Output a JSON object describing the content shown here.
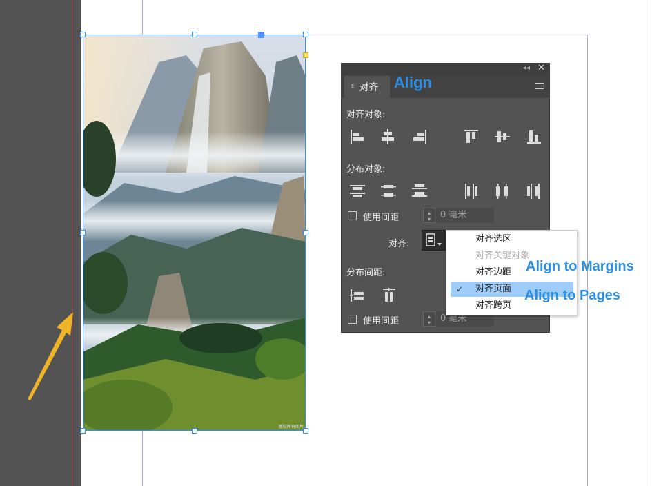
{
  "align_panel": {
    "tab_label": "对齐",
    "sections": {
      "align_objects": "对齐对象:",
      "distribute_objects": "分布对象:",
      "distribute_spacing": "分布间距:"
    },
    "use_spacing_label_1": "使用间距",
    "spacing_value_1": "0 毫米",
    "use_spacing_label_2": "使用间距",
    "spacing_value_2": "0 毫米",
    "align_to_label": "对齐:"
  },
  "align_to_dropdown": {
    "items": [
      {
        "label": "对齐选区",
        "state": "enabled"
      },
      {
        "label": "对齐关键对象",
        "state": "disabled"
      },
      {
        "label": "对齐边距",
        "state": "enabled"
      },
      {
        "label": "对齐页面",
        "state": "selected"
      },
      {
        "label": "对齐跨页",
        "state": "enabled"
      }
    ],
    "check_mark": "✓"
  },
  "annotations": {
    "align": "Align",
    "align_to_margins": "Align to Margins",
    "align_to_pages": "Align to Pages"
  },
  "image": {
    "watermark": "版权所有图片"
  },
  "colors": {
    "annotation": "#2a8ee6",
    "arrow": "#f0b429",
    "selection": "#2d8cff",
    "panel_bg": "#535353",
    "dropdown_highlight": "#9fcdf9"
  }
}
